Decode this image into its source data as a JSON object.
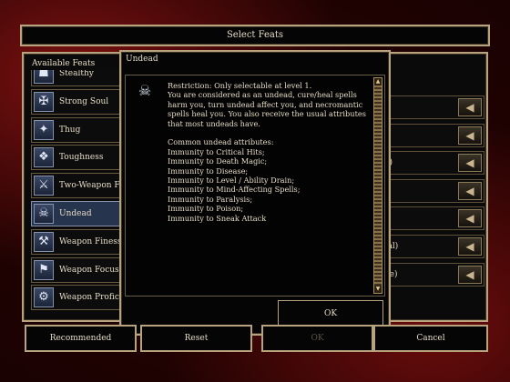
{
  "window": {
    "title": "Select Feats"
  },
  "available_feats": {
    "label": "Available Feats",
    "items": [
      {
        "label": "Stealthy",
        "icon": "stealthy-icon",
        "glyph": "☗",
        "selected": false
      },
      {
        "label": "Strong Soul",
        "icon": "strong-soul-icon",
        "glyph": "✠",
        "selected": false
      },
      {
        "label": "Thug",
        "icon": "thug-icon",
        "glyph": "✦",
        "selected": false
      },
      {
        "label": "Toughness",
        "icon": "toughness-icon",
        "glyph": "❖",
        "selected": false
      },
      {
        "label": "Two-Weapon F",
        "icon": "two-weapon-icon",
        "glyph": "⚔",
        "selected": false
      },
      {
        "label": "Undead",
        "icon": "undead-icon",
        "glyph": "☠",
        "selected": true
      },
      {
        "label": "Weapon Finesse",
        "icon": "weapon-finesse-icon",
        "glyph": "⚒",
        "selected": false
      },
      {
        "label": "Weapon Focus",
        "icon": "weapon-focus-icon",
        "glyph": "⚑",
        "selected": false
      },
      {
        "label": "Weapon Profici",
        "icon": "weapon-proficiency-icon",
        "glyph": "⚙",
        "selected": false
      }
    ]
  },
  "selected_feats": {
    "items": [
      {
        "label": "l)"
      },
      {
        "label": ""
      },
      {
        "label": "m)"
      },
      {
        "label": ""
      },
      {
        "label": ""
      },
      {
        "label": "tial)"
      },
      {
        "label": "ble)"
      }
    ],
    "remove_icon": "left-arrow-icon",
    "remove_glyph": "◀"
  },
  "dialog": {
    "title": "Undead",
    "icon": "undead-icon",
    "icon_glyph": "☠",
    "description": [
      "Restriction: Only selectable at level 1.",
      "You are considered as an undead, cure/heal spells harm you, turn undead affect you, and necromantic spells heal you. You also receive the usual attributes that most undeads have.",
      "",
      "Common undead attributes:",
      "Immunity to Critical Hits;",
      "Immunity to Death Magic;",
      "Immunity to Disease;",
      "Immunity to Level / Ability Drain;",
      "Immunity to Mind-Affecting Spells;",
      "Immunity to Paralysis;",
      "Immunity to Poison;",
      "Immunity to Sneak Attack"
    ],
    "ok_label": "OK"
  },
  "buttons": {
    "recommended": "Recommended",
    "reset": "Reset",
    "ok": "OK",
    "cancel": "Cancel"
  }
}
